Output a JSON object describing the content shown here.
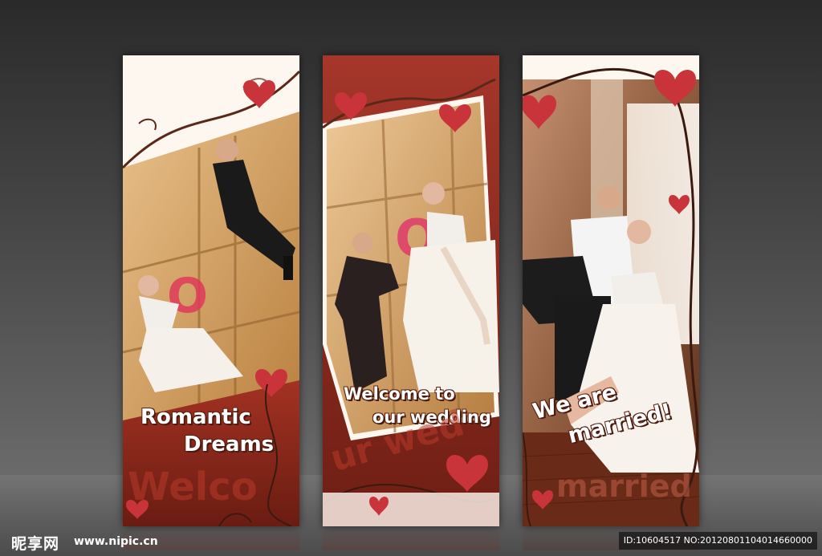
{
  "banners": [
    {
      "title_line1": "Romantic",
      "title_line2": "Dreams",
      "watermark": "Welco"
    },
    {
      "title_line1": "Welcome to",
      "title_line2": "our wedding",
      "watermark": "ur wed"
    },
    {
      "title_line1": "We are",
      "title_line2": "married!",
      "watermark": "married"
    }
  ],
  "footer": {
    "site_name": "昵享网",
    "url": "www.nipic.cn",
    "id_text": "ID:10604517 NO:20120801104014660000"
  },
  "colors": {
    "banner_red": "#8c2a1c",
    "heart_red": "#c8343a",
    "wood": "#d9a56a"
  }
}
